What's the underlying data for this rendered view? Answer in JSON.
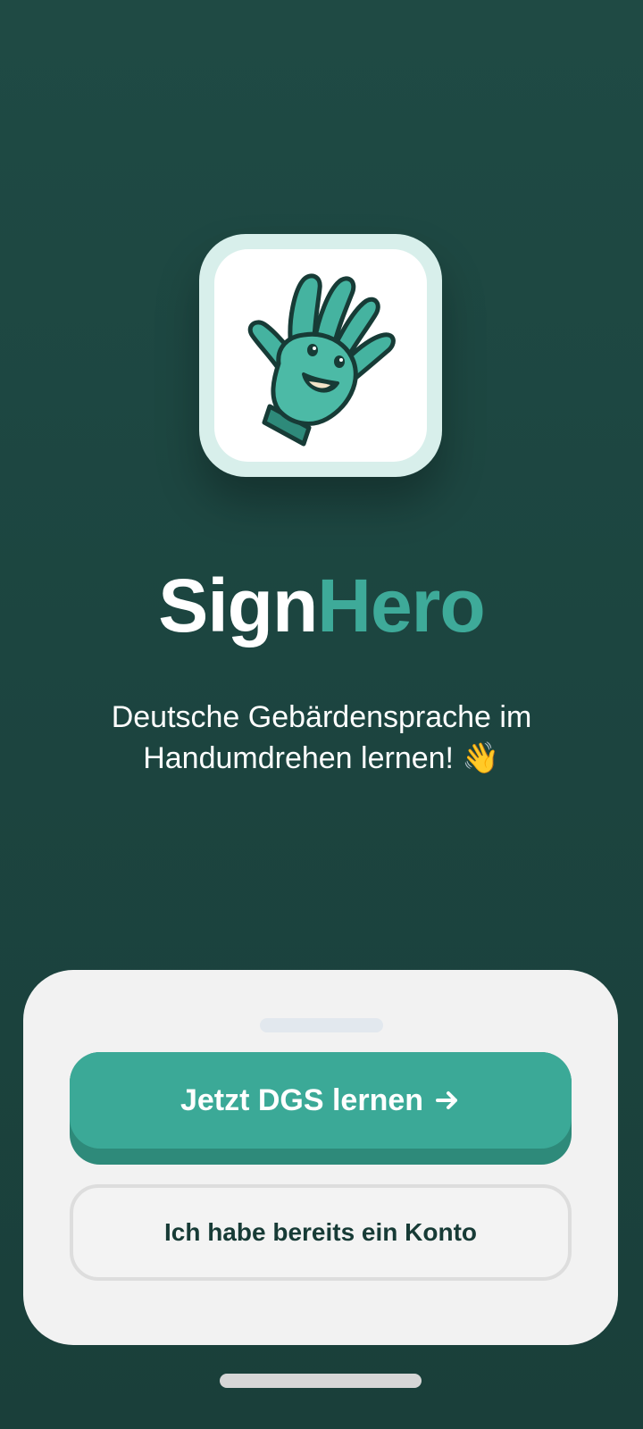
{
  "app": {
    "title_part_1": "Sign",
    "title_part_2": "Hero",
    "logo_icon": "waving-hand-mascot-icon"
  },
  "tagline": {
    "line_1": "Deutsche Gebärdensprache im",
    "line_2": "Handumdrehen lernen! 👋"
  },
  "actions": {
    "primary_label": "Jetzt DGS lernen",
    "primary_icon": "arrow-right-icon",
    "secondary_label": "Ich habe bereits ein Konto"
  },
  "colors": {
    "background": "#1f4a44",
    "accent": "#3ba997",
    "accent_dark": "#2e8a7a",
    "sheet": "#f2f2f2",
    "text_dark": "#173b36"
  }
}
